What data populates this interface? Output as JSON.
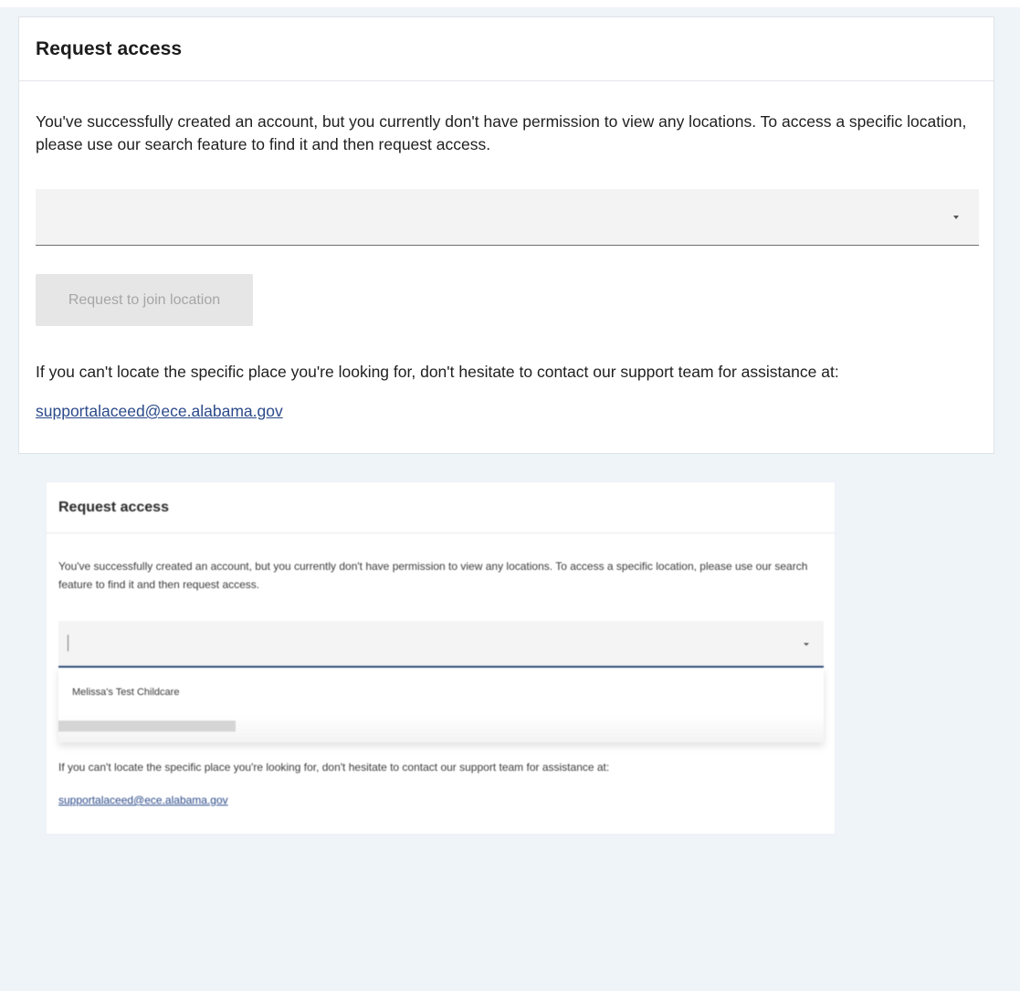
{
  "panel1": {
    "title": "Request access",
    "description": "You've successfully created an account, but you currently don't have permission to view any locations. To access a specific location, please use our search feature to find it and then request access.",
    "location_select": {
      "value": ""
    },
    "request_button_label": "Request to join location",
    "request_button_state": "disabled",
    "help_text": "If you can't locate the specific place you're looking for, don't hesitate to contact our support team for assistance at:",
    "support_email": "supportalaceed@ece.alabama.gov"
  },
  "panel2": {
    "title": "Request access",
    "description": "You've successfully created an account, but you currently don't have permission to view any locations. To access a specific location, please use our search feature to find it and then request access.",
    "location_select": {
      "value": "",
      "state": "focused"
    },
    "dropdown_options": [
      "Melissa's Test Childcare"
    ],
    "help_text": "If you can't locate the specific place you're looking for, don't hesitate to contact our support team for assistance at:",
    "support_email": "supportalaceed@ece.alabama.gov"
  },
  "icons": {
    "dropdown_arrow": "chevron-down-icon"
  },
  "colors": {
    "page_background": "#eff4f9",
    "panel_background": "#ffffff",
    "link": "#2b4a8a",
    "disabled_button_bg": "#e6e6e6",
    "disabled_button_text": "#a6a6a6",
    "focus_underline": "#2d4b78"
  }
}
